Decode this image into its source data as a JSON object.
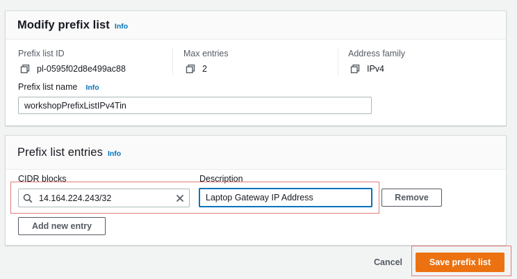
{
  "modify_panel": {
    "title": "Modify prefix list",
    "info": "Info",
    "prefix_list_id_label": "Prefix list ID",
    "prefix_list_id_value": "pl-0595f02d8e499ac88",
    "max_entries_label": "Max entries",
    "max_entries_value": "2",
    "address_family_label": "Address family",
    "address_family_value": "IPv4",
    "name_label": "Prefix list name",
    "name_info": "Info",
    "name_value": "workshopPrefixListIPv4Tin"
  },
  "entries_panel": {
    "title": "Prefix list entries",
    "info": "Info",
    "cidr_label": "CIDR blocks",
    "description_label": "Description",
    "entries": [
      {
        "cidr": "14.164.224.243/32",
        "description": "Laptop Gateway IP Address",
        "remove_label": "Remove"
      }
    ],
    "add_entry_label": "Add new entry"
  },
  "footer": {
    "cancel_label": "Cancel",
    "save_label": "Save prefix list"
  },
  "icons": {
    "copy": "copy-icon",
    "search": "search-icon",
    "clear": "close-icon"
  },
  "colors": {
    "primary": "#ec7211",
    "link": "#0073bb",
    "focus": "#0073bb",
    "annotation": "#e07a7a"
  }
}
